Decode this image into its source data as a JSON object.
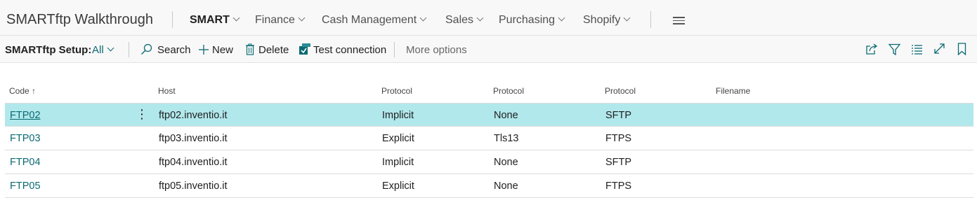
{
  "app": {
    "title": "SMARTftp Walkthrough"
  },
  "nav": {
    "items": [
      {
        "label": "SMART",
        "active": true
      },
      {
        "label": "Finance"
      },
      {
        "label": "Cash Management"
      },
      {
        "label": "Sales"
      },
      {
        "label": "Purchasing"
      },
      {
        "label": "Shopify"
      }
    ],
    "menu_icon": "hamburger-icon"
  },
  "actionbar": {
    "page_label": "SMARTftp Setup:",
    "filter_value": "All",
    "search_label": "Search",
    "new_label": "New",
    "delete_label": "Delete",
    "test_label": "Test connection",
    "more_label": "More options",
    "right_icons": [
      "share-icon",
      "filter-icon",
      "list-icon",
      "expand-icon",
      "bookmark-icon"
    ]
  },
  "table": {
    "columns": [
      "Code ↑",
      "Host",
      "Protocol",
      "Protocol",
      "Protocol",
      "Filename"
    ],
    "rows": [
      {
        "code": "FTP02",
        "host": "ftp02.inventio.it",
        "p1": "Implicit",
        "p2": "None",
        "p3": "SFTP",
        "filename": ""
      },
      {
        "code": "FTP03",
        "host": "ftp03.inventio.it",
        "p1": "Explicit",
        "p2": "Tls13",
        "p3": "FTPS",
        "filename": ""
      },
      {
        "code": "FTP04",
        "host": "ftp04.inventio.it",
        "p1": "Implicit",
        "p2": "None",
        "p3": "SFTP",
        "filename": ""
      },
      {
        "code": "FTP05",
        "host": "ftp05.inventio.it",
        "p1": "Explicit",
        "p2": "None",
        "p3": "FTPS",
        "filename": ""
      }
    ]
  },
  "colors": {
    "accent": "#0b6a72",
    "selected_row": "#b1e8ec"
  }
}
